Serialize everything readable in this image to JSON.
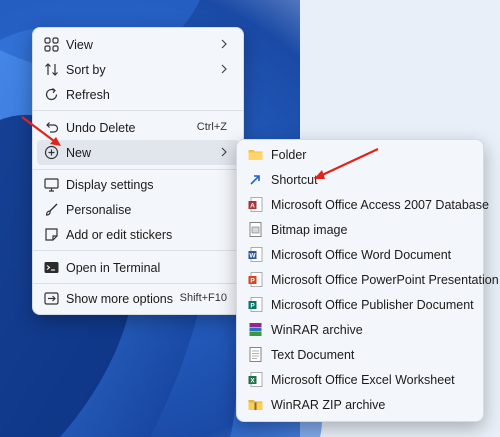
{
  "context_menu": {
    "items": [
      {
        "label": "View",
        "icon": "grid-icon"
      },
      {
        "label": "Sort by",
        "icon": "sort-icon"
      },
      {
        "label": "Refresh",
        "icon": "refresh-icon"
      },
      {
        "label": "Undo Delete",
        "icon": "undo-icon",
        "shortcut": "Ctrl+Z"
      },
      {
        "label": "New",
        "icon": "new-icon"
      },
      {
        "label": "Display settings",
        "icon": "display-icon"
      },
      {
        "label": "Personalise",
        "icon": "brush-icon"
      },
      {
        "label": "Add or edit stickers",
        "icon": "sticker-icon"
      },
      {
        "label": "Open in Terminal",
        "icon": "terminal-icon"
      },
      {
        "label": "Show more options",
        "icon": "more-options-icon",
        "shortcut": "Shift+F10"
      }
    ]
  },
  "new_submenu": {
    "items": [
      {
        "label": "Folder",
        "icon": "folder-icon"
      },
      {
        "label": "Shortcut",
        "icon": "shortcut-icon"
      },
      {
        "label": "Microsoft Office Access 2007 Database",
        "icon": "access-icon"
      },
      {
        "label": "Bitmap image",
        "icon": "bitmap-icon"
      },
      {
        "label": "Microsoft Office Word Document",
        "icon": "word-icon"
      },
      {
        "label": "Microsoft Office PowerPoint Presentation",
        "icon": "powerpoint-icon"
      },
      {
        "label": "Microsoft Office Publisher Document",
        "icon": "publisher-icon"
      },
      {
        "label": "WinRAR archive",
        "icon": "winrar-icon"
      },
      {
        "label": "Text Document",
        "icon": "text-document-icon"
      },
      {
        "label": "Microsoft Office Excel Worksheet",
        "icon": "excel-icon"
      },
      {
        "label": "WinRAR ZIP archive",
        "icon": "winrar-zip-icon"
      }
    ]
  },
  "colors": {
    "annotation_arrow": "#e0241b",
    "menu_background": "#f3f6fb",
    "hover_background": "#e1e5ec",
    "wallpaper_blue": "#1a4fa8"
  }
}
